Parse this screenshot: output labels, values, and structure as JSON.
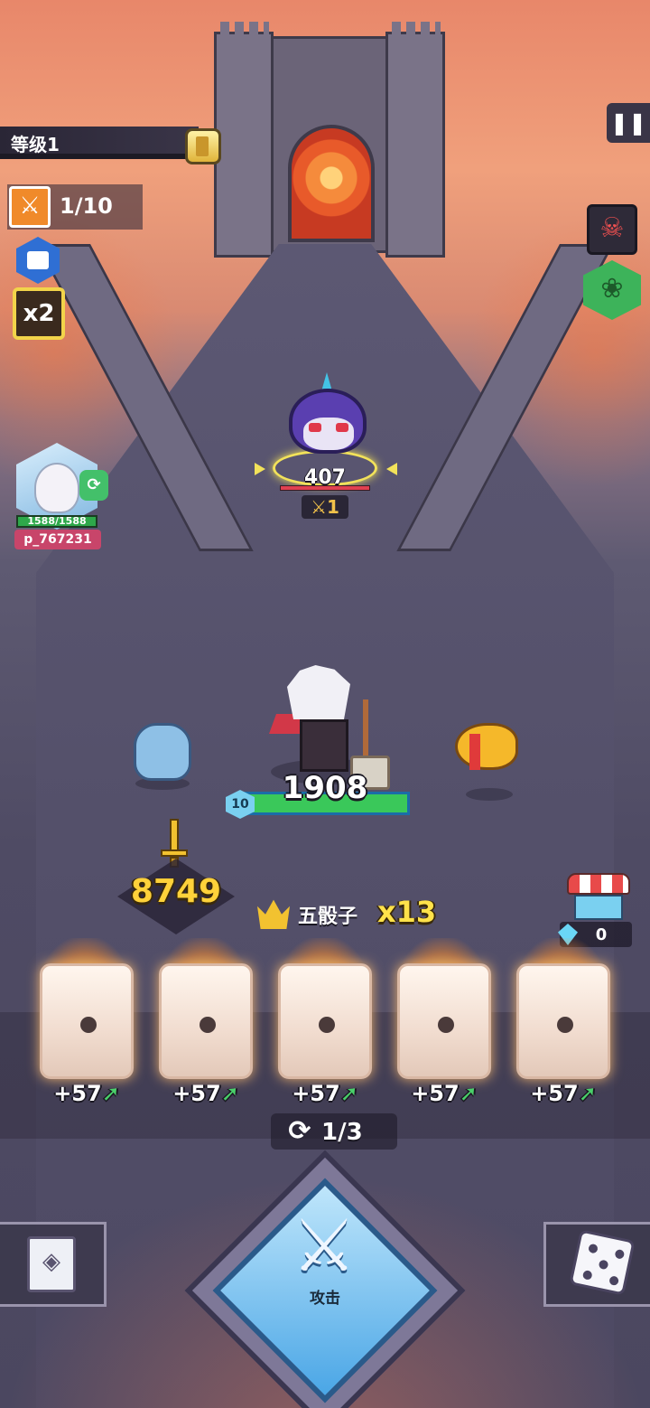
{
  "hud": {
    "level_label": "等级1",
    "stage_progress": "1/10",
    "speed_multiplier": "x2",
    "pause_icon": "pause-icon",
    "skull_icon": "skull-icon",
    "paw_icon": "paw-icon"
  },
  "player": {
    "hp": "1588/1588",
    "name": "p_767231"
  },
  "enemy": {
    "hp": "407",
    "attack_level": "1"
  },
  "hero": {
    "level": "10",
    "hp": "1908"
  },
  "power": {
    "value": "8749"
  },
  "combo": {
    "label": "五骰子",
    "multiplier": "x13"
  },
  "shop": {
    "gems": "0"
  },
  "dice": [
    {
      "bonus": "+57"
    },
    {
      "bonus": "+57"
    },
    {
      "bonus": "+57"
    },
    {
      "bonus": "+57"
    },
    {
      "bonus": "+57"
    }
  ],
  "reroll": {
    "count": "1/3"
  },
  "controls": {
    "attack_label": "攻击"
  },
  "colors": {
    "hp_green": "#3ac85a",
    "gold": "#ffd23a",
    "accent_blue": "#4aa6e6"
  }
}
